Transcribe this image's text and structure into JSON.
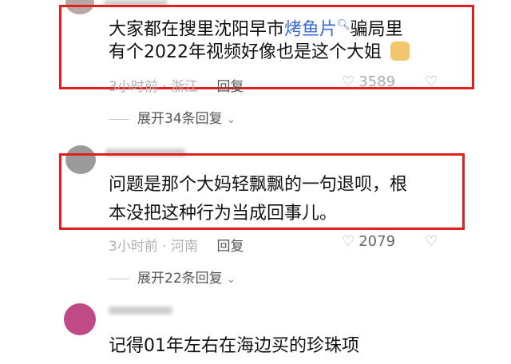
{
  "comments": [
    {
      "text_before": "大家都在搜里沈阳早市",
      "keyword": "烤鱼片",
      "text_after": "骗局里",
      "line2": "有个2022年视频好像也是这个大姐",
      "time": "3小时前",
      "location": "浙江",
      "reply_label": "回复",
      "likes": "3589",
      "expand_label": "展开34条回复"
    },
    {
      "line1": "问题是那个大妈轻飘飘的一句退呗，根",
      "line2": "本没把这种行为当成回事儿。",
      "time": "3小时前",
      "location": "河南",
      "reply_label": "回复",
      "likes": "2079",
      "expand_label": "展开22条回复"
    },
    {
      "line1": "记得01年左右在海边买的珍珠项"
    }
  ],
  "colors": {
    "highlight_box": "#e02020",
    "keyword": "#3b6bd6"
  }
}
